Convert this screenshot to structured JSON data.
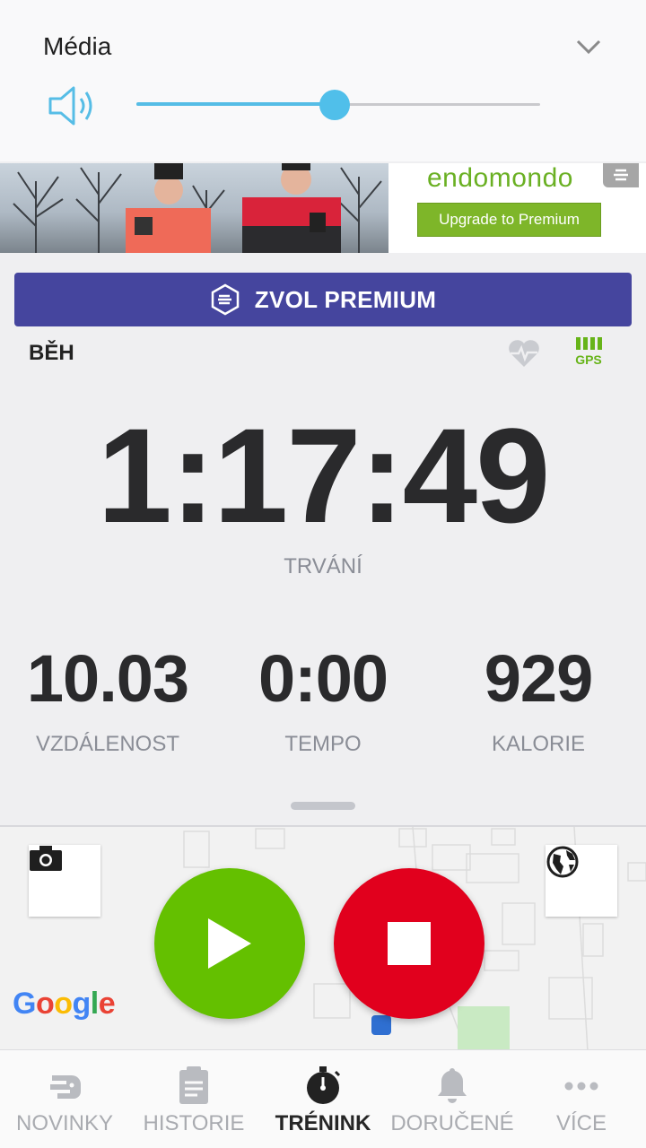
{
  "media": {
    "title": "Média",
    "volume_fraction": 0.49
  },
  "ad": {
    "brand": "endomondo",
    "cta_label": "Upgrade to Premium"
  },
  "premium_label": "ZVOL PREMIUM",
  "workout": {
    "sport": "BĚH",
    "gps_label": "GPS",
    "duration": "1:17:49",
    "duration_label": "TRVÁNÍ",
    "stats": [
      {
        "value": "10.03",
        "label": "VZDÁLENOST"
      },
      {
        "value": "0:00",
        "label": "TEMPO"
      },
      {
        "value": "929",
        "label": "KALORIE"
      }
    ]
  },
  "map": {
    "attribution": "Google"
  },
  "nav": {
    "items": [
      {
        "label": "NOVINKY",
        "icon": "news-icon",
        "active": false
      },
      {
        "label": "HISTORIE",
        "icon": "history-icon",
        "active": false
      },
      {
        "label": "TRÉNINK",
        "icon": "stopwatch-icon",
        "active": true
      },
      {
        "label": "DORUČENÉ",
        "icon": "bell-icon",
        "active": false
      },
      {
        "label": "VÍCE",
        "icon": "more-icon",
        "active": false
      }
    ]
  },
  "colors": {
    "accent_blue": "#50bfea",
    "premium_purple": "#45459e",
    "start_green": "#64c000",
    "stop_red": "#e1001d",
    "gps_green": "#67b419"
  }
}
